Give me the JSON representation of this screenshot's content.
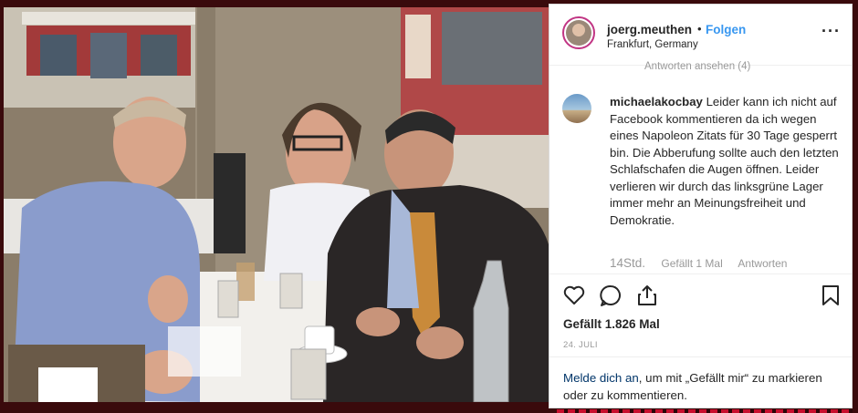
{
  "post": {
    "username": "joerg.meuthen",
    "separator": "•",
    "follow_label": "Folgen",
    "location": "Frankfurt, Germany",
    "more_icon": "more-dots-icon"
  },
  "comments": {
    "peek_text": "Antworten ansehen (4)",
    "comment": {
      "username": "michaelakocbay",
      "text": "Leider kann ich nicht auf Facebook kommentieren da ich wegen eines Napoleon Zitats für 30 Tage gesperrt bin. Die Abberufung sollte auch den letzten Schlafschafen die Augen öffnen. Leider verlieren wir durch das linksgrüne Lager immer mehr an Meinungsfreiheit und Demokratie.",
      "time": "14Std.",
      "likes": "Gefällt 1 Mal",
      "reply_label": "Antworten"
    }
  },
  "actions": {
    "like_icon": "heart-icon",
    "comment_icon": "comment-icon",
    "share_icon": "share-icon",
    "save_icon": "bookmark-icon"
  },
  "likes_text": "Gefällt 1.826 Mal",
  "date": "24. JULI",
  "login": {
    "link": "Melde dich an",
    "rest": ", um mit „Gefällt mir“ zu markieren oder zu kommentieren."
  },
  "colors": {
    "link_blue": "#3897f0",
    "text": "#262626",
    "muted": "#999999",
    "login_link": "#003569"
  }
}
